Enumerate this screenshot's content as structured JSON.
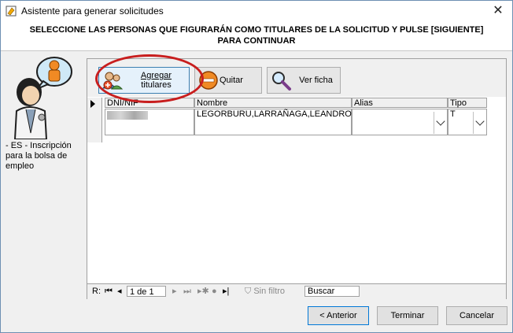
{
  "window": {
    "title": "Asistente para generar solicitudes"
  },
  "header": {
    "instruction": "SELECCIONE LAS PERSONAS QUE FIGURARÁN COMO TITULARES DE LA SOLICITUD Y PULSE [SIGUIENTE] PARA CONTINUAR"
  },
  "left": {
    "caption": "- ES - Inscripción para la bolsa de empleo"
  },
  "toolbar": {
    "agregar_line1": "Agregar",
    "agregar_line2": "titulares",
    "quitar_label": "Quitar",
    "ver_label": "Ver ficha"
  },
  "grid": {
    "columns": [
      "DNI/NIF",
      "Nombre",
      "Alias",
      "Tipo"
    ],
    "rows": [
      {
        "dni": "",
        "nombre": "LEGORBURU,LARRAÑAGA,LEANDRO",
        "alias": "",
        "tipo": "T"
      }
    ]
  },
  "navigator": {
    "record_label": "R:",
    "position": "1 de 1",
    "filter_label": "Sin filtro",
    "search_placeholder": "Buscar"
  },
  "buttons": {
    "anterior": "< Anterior",
    "terminar": "Terminar",
    "cancelar": "Cancelar"
  },
  "colors": {
    "highlight": "#c81e1e",
    "selected_button": "#e5f1fb"
  },
  "icons": [
    "app-icon",
    "close-icon",
    "person-wizard-icon",
    "add-people-icon",
    "remove-icon",
    "magnifier-icon",
    "dropdown-chevron-icon",
    "funnel-icon"
  ]
}
